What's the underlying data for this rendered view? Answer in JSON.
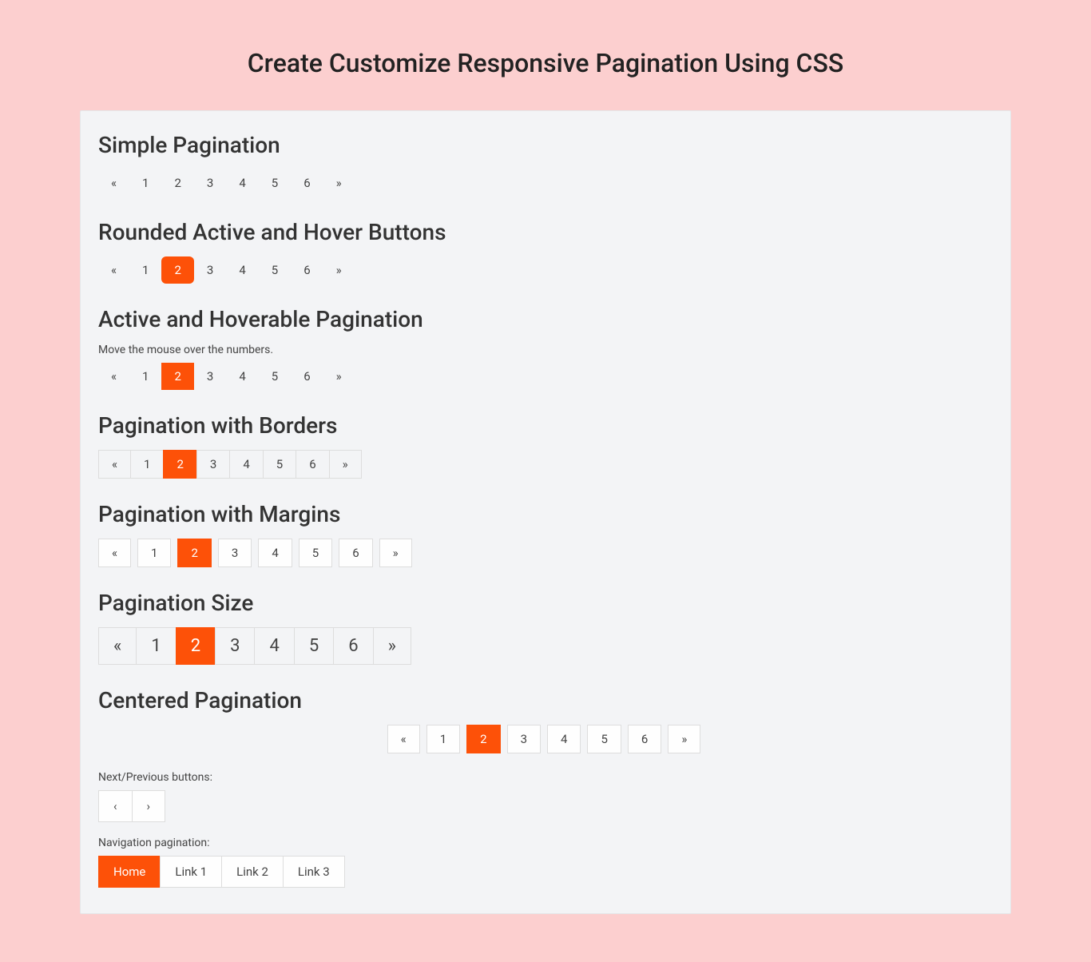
{
  "title": "Create Customize Responsive Pagination Using CSS",
  "sections": {
    "simple": {
      "heading": "Simple Pagination",
      "items": [
        "«",
        "1",
        "2",
        "3",
        "4",
        "5",
        "6",
        "»"
      ]
    },
    "rounded": {
      "heading": "Rounded Active and Hover Buttons",
      "items": [
        "«",
        "1",
        "2",
        "3",
        "4",
        "5",
        "6",
        "»"
      ],
      "active": "2"
    },
    "hoverable": {
      "heading": "Active and Hoverable Pagination",
      "hint": "Move the mouse over the numbers.",
      "items": [
        "«",
        "1",
        "2",
        "3",
        "4",
        "5",
        "6",
        "»"
      ],
      "active": "2"
    },
    "borders": {
      "heading": "Pagination with Borders",
      "items": [
        "«",
        "1",
        "2",
        "3",
        "4",
        "5",
        "6",
        "»"
      ],
      "active": "2"
    },
    "margins": {
      "heading": "Pagination with Margins",
      "items": [
        "«",
        "1",
        "2",
        "3",
        "4",
        "5",
        "6",
        "»"
      ],
      "active": "2"
    },
    "size": {
      "heading": "Pagination Size",
      "items": [
        "«",
        "1",
        "2",
        "3",
        "4",
        "5",
        "6",
        "»"
      ],
      "active": "2"
    },
    "centered": {
      "heading": "Centered Pagination",
      "items": [
        "«",
        "1",
        "2",
        "3",
        "4",
        "5",
        "6",
        "»"
      ],
      "active": "2"
    },
    "nextprev": {
      "label": "Next/Previous buttons:",
      "items": [
        "‹",
        "›"
      ]
    },
    "navlinks": {
      "label": "Navigation pagination:",
      "items": [
        "Home",
        "Link 1",
        "Link 2",
        "Link 3"
      ],
      "active": "Home"
    }
  }
}
